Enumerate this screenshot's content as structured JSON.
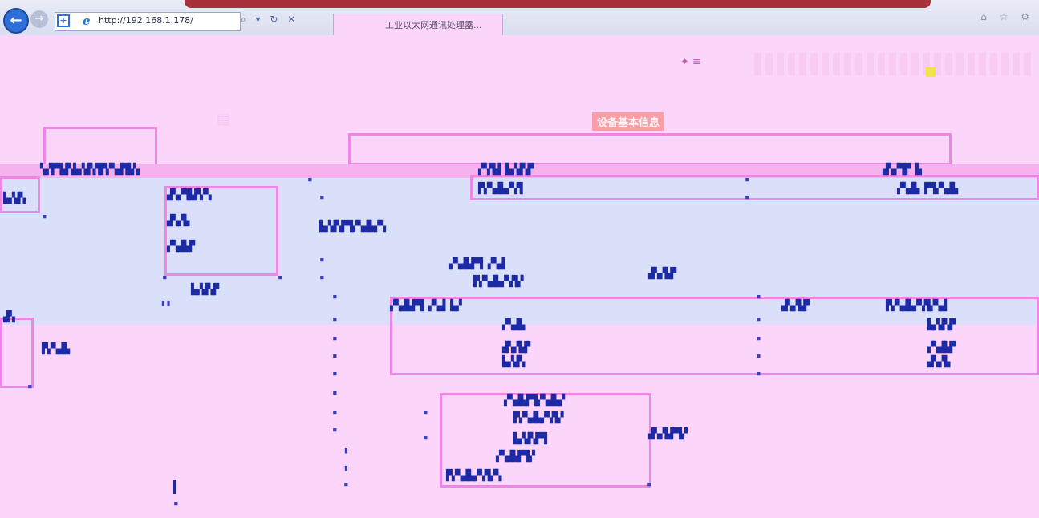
{
  "browser": {
    "back_glyph": "←",
    "forward_glyph": "→",
    "shield_glyph": "+",
    "address": "http://192.168.1.178/",
    "ie_glyph": "e",
    "tab_title": "工业以太网通讯处理器..."
  },
  "page": {
    "section_title": "设备基本信息"
  }
}
